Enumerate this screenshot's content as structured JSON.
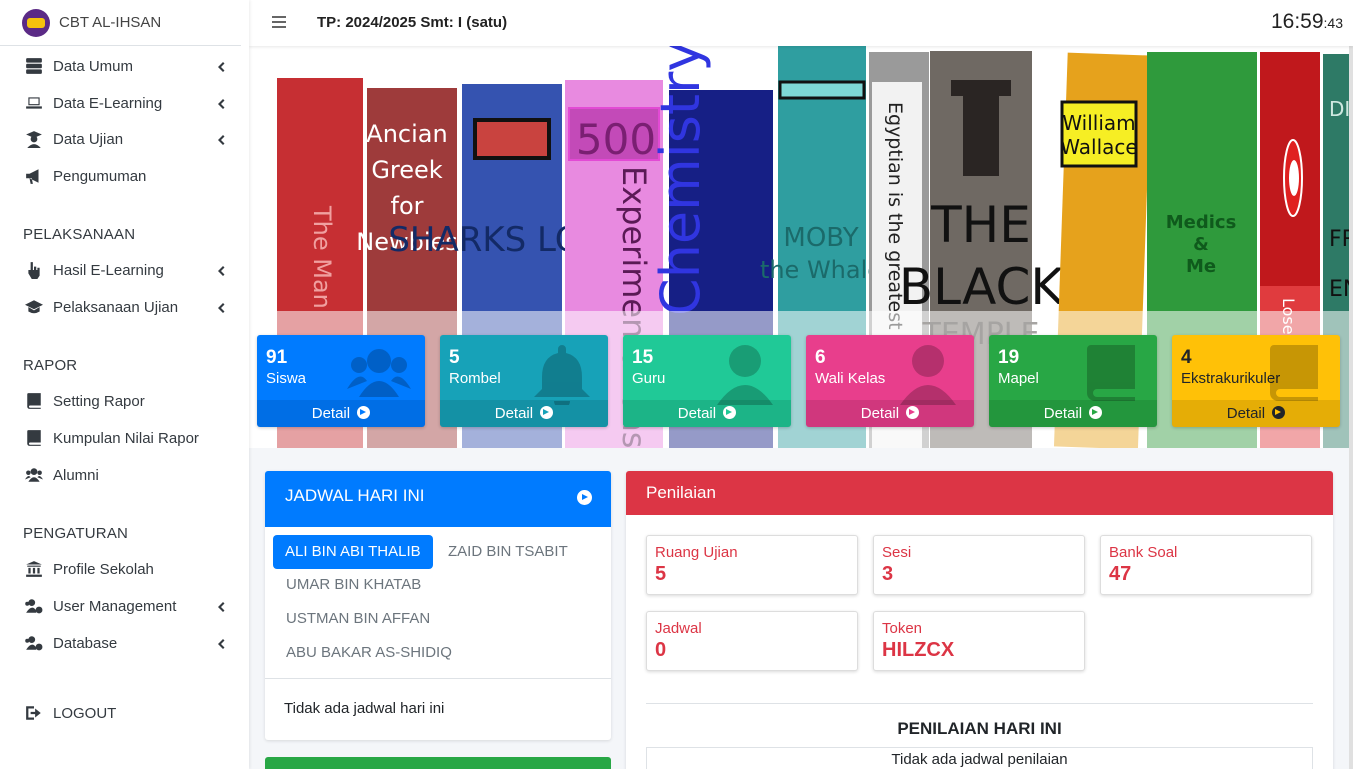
{
  "app": {
    "brand": "CBT AL-IHSAN"
  },
  "topbar": {
    "tp": "TP: 2024/2025 Smt: I (satu)",
    "clock_hm": "16:59",
    "clock_s": ":43"
  },
  "sidebar": {
    "items": [
      {
        "label": "Data Umum",
        "icon": "server-icon",
        "chevron": true
      },
      {
        "label": "Data E-Learning",
        "icon": "laptop-icon",
        "chevron": true
      },
      {
        "label": "Data Ujian",
        "icon": "user-graduate-icon",
        "chevron": true
      },
      {
        "label": "Pengumuman",
        "icon": "bullhorn-icon",
        "chevron": false
      },
      {
        "label": "Hasil E-Learning",
        "icon": "hand-pointer-icon",
        "chevron": true
      },
      {
        "label": "Pelaksanaan Ujian",
        "icon": "graduation-cap-icon",
        "chevron": true
      },
      {
        "label": "Setting Rapor",
        "icon": "book-icon",
        "chevron": false
      },
      {
        "label": "Kumpulan Nilai Rapor",
        "icon": "book-icon",
        "chevron": false
      },
      {
        "label": "Alumni",
        "icon": "users-icon",
        "chevron": false
      },
      {
        "label": "Profile Sekolah",
        "icon": "landmark-icon",
        "chevron": false
      },
      {
        "label": "User Management",
        "icon": "users-cog-icon",
        "chevron": true
      },
      {
        "label": "Database",
        "icon": "users-cog-icon",
        "chevron": true
      },
      {
        "label": "LOGOUT",
        "icon": "sign-out-icon",
        "chevron": false
      }
    ],
    "headers": [
      "PELAKSANAAN",
      "RAPOR",
      "PENGATURAN"
    ]
  },
  "banner": {
    "books": [
      "The Man",
      "Ancian Greek for Newbies",
      "SHARKS LOVE",
      "500",
      "Experimentations",
      "Chemistry",
      "MOBY the Whale",
      "Egyptian is the greatest langu",
      "THE BLACK TEMPLE",
      "William Wallace",
      "Medics & Me",
      "Lose to Us",
      "DIC",
      "FR",
      "EN"
    ]
  },
  "stats": [
    {
      "num": "91",
      "label": "Siswa",
      "detail": "Detail",
      "color": "#007bff",
      "icon": "users-icon"
    },
    {
      "num": "5",
      "label": "Rombel",
      "detail": "Detail",
      "color": "#17a2b8",
      "icon": "bell-icon"
    },
    {
      "num": "15",
      "label": "Guru",
      "detail": "Detail",
      "color": "#20c997",
      "icon": "user-icon"
    },
    {
      "num": "6",
      "label": "Wali Kelas",
      "detail": "Detail",
      "color": "#e83e8c",
      "icon": "user-icon"
    },
    {
      "num": "19",
      "label": "Mapel",
      "detail": "Detail",
      "color": "#28a745",
      "icon": "book-icon"
    },
    {
      "num": "4",
      "label": "Ekstrakurikuler",
      "detail": "Detail",
      "color": "#ffc107",
      "icon": "book-icon"
    }
  ],
  "jadwal": {
    "title": "JADWAL HARI INI",
    "tabs": [
      "ALI BIN ABI THALIB",
      "ZAID BIN TSABIT",
      "UMAR BIN KHATAB",
      "USTMAN BIN AFFAN",
      "ABU BAKAR AS-SHIDIQ"
    ],
    "empty": "Tidak ada jadwal hari ini"
  },
  "penilaian": {
    "title": "Penilaian",
    "boxes": [
      {
        "label": "Ruang Ujian",
        "value": "5"
      },
      {
        "label": "Sesi",
        "value": "3"
      },
      {
        "label": "Bank Soal",
        "value": "47"
      },
      {
        "label": "Jadwal",
        "value": "0"
      },
      {
        "label": "Token",
        "value": "HILZCX"
      }
    ],
    "subtitle": "PENILAIAN HARI INI",
    "empty": "Tidak ada jadwal penilaian"
  }
}
